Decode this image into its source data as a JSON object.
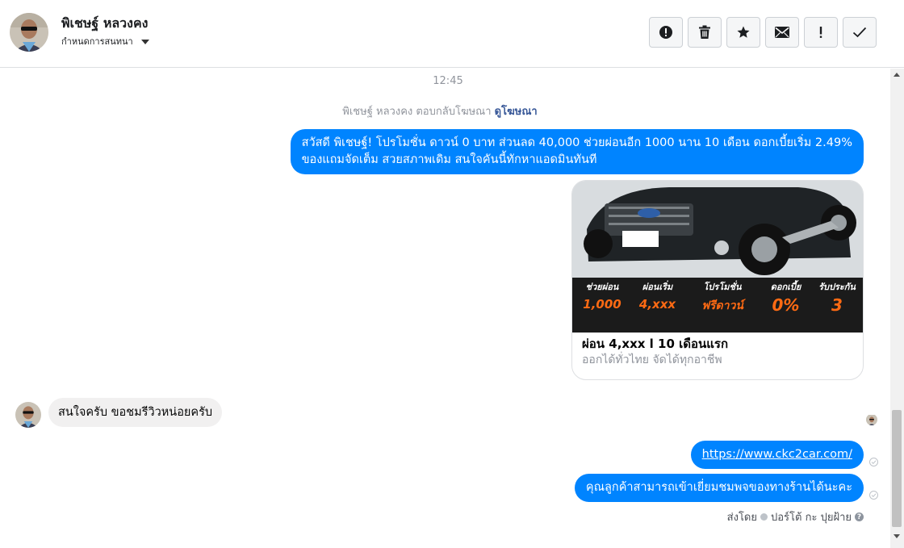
{
  "header": {
    "contact_name": "พิเชษฐ์ หลวงคง",
    "assign_label": "กำหนดการสนทนา",
    "toolbar": [
      {
        "name": "report-spam-button",
        "icon": "exclamation-circle-icon"
      },
      {
        "name": "delete-button",
        "icon": "trash-icon"
      },
      {
        "name": "star-button",
        "icon": "star-icon"
      },
      {
        "name": "mark-unread-button",
        "icon": "envelope-icon"
      },
      {
        "name": "mark-follow-up-button",
        "icon": "exclamation-icon"
      },
      {
        "name": "mark-done-button",
        "icon": "checkmark-icon"
      }
    ]
  },
  "thread": {
    "timestamp": "12:45",
    "reply_notice": "พิเชษฐ์ หลวงคง ตอบกลับโฆษณา",
    "reply_link": "ดูโฆษณา",
    "ad_message_line1": "สวัสดี พิเชษฐ์! โปรโมชั่น ดาวน์ 0 บาท ส่วนลด 40,000 ช่วยผ่อนอีก 1000 นาน 10 เดือน ดอกเบี้ยเริ่ม 2.49%",
    "ad_message_line2": "ของแถมจัดเต็ม สวยสภาพเดิม สนใจคันนี้ทักหาแอดมินทันที",
    "ad_card": {
      "title": "ผ่อน 4,xxx l 10 เดือนแรก",
      "subtitle": "ออกได้ทั่วไทย จัดได้ทุกอาชีพ",
      "promo": [
        {
          "label": "ช่วยผ่อน",
          "value": "1,000"
        },
        {
          "label": "ผ่อนเริ่ม",
          "value": "4,xxx"
        },
        {
          "label": "โปรโมชั่น",
          "value": "ฟรีดาวน์"
        },
        {
          "label": "ดอกเบี้ย",
          "value": "0%"
        },
        {
          "label": "รับประกัน",
          "value": "3"
        }
      ]
    },
    "incoming_message": "สนใจครับ ขอชมรีวิวหน่อยครับ",
    "link_message": "https://www.ckc2car.com/",
    "outgoing_message": "คุณลูกค้าสามารถเข้าเยี่ยมชมพจของทางร้านได้นะคะ",
    "sent_by_label": "ส่งโดย",
    "sent_by_name": "ปอร์โต้ กะ ปุยฝ้าย"
  },
  "colors": {
    "accent": "#0084ff",
    "incoming_bubble": "#f1f0f0",
    "link": "#385898",
    "muted": "#90949c"
  }
}
